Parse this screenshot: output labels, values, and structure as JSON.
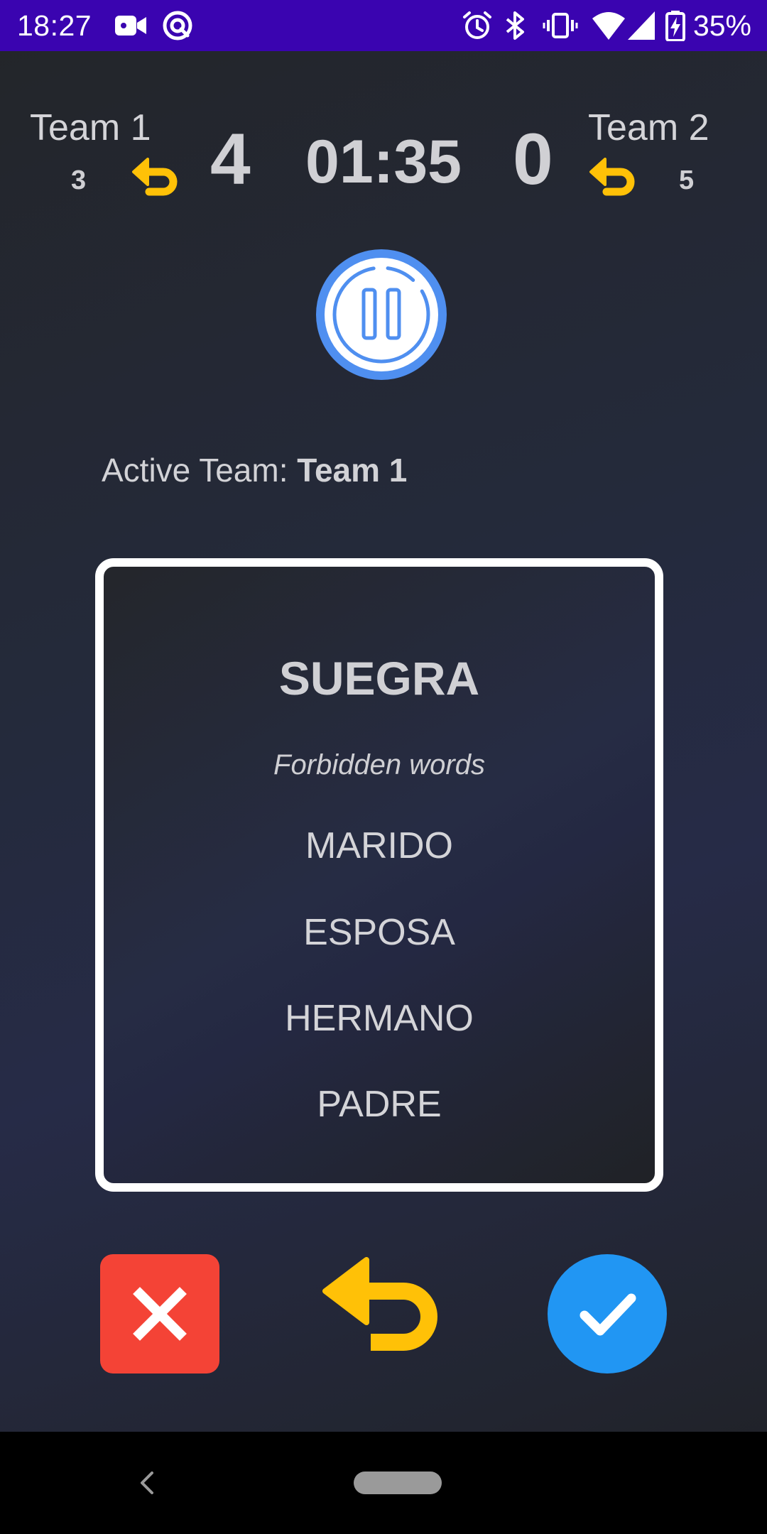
{
  "status_bar": {
    "time": "18:27",
    "battery": "35%",
    "icons": [
      "video-camera-icon",
      "location-sharing-icon",
      "alarm-icon",
      "bluetooth-icon",
      "vibrate-icon",
      "wifi-icon",
      "signal-icon",
      "battery-charging-icon"
    ],
    "background": "#3a04b0"
  },
  "scoreboard": {
    "team1": {
      "name": "Team 1",
      "skips": "3",
      "score": "4"
    },
    "team2": {
      "name": "Team 2",
      "skips": "5",
      "score": "0"
    },
    "timer": "01:35",
    "undo_icon_color": "#ffc107"
  },
  "pause_button": {
    "icon": "pause-icon",
    "color": "#4f8ff0"
  },
  "active_team": {
    "label": "Active Team:",
    "value": "Team 1"
  },
  "card": {
    "word": "SUEGRA",
    "forbidden_title": "Forbidden words",
    "forbidden_words": [
      "MARIDO",
      "ESPOSA",
      "HERMANO",
      "PADRE"
    ]
  },
  "actions": {
    "wrong": {
      "icon": "close-icon",
      "color": "#f44336"
    },
    "undo": {
      "icon": "undo-icon",
      "color": "#ffc107"
    },
    "correct": {
      "icon": "check-icon",
      "color": "#2196f3"
    }
  },
  "nav_bar": {
    "icons": [
      "back-icon",
      "home-pill-icon"
    ]
  }
}
